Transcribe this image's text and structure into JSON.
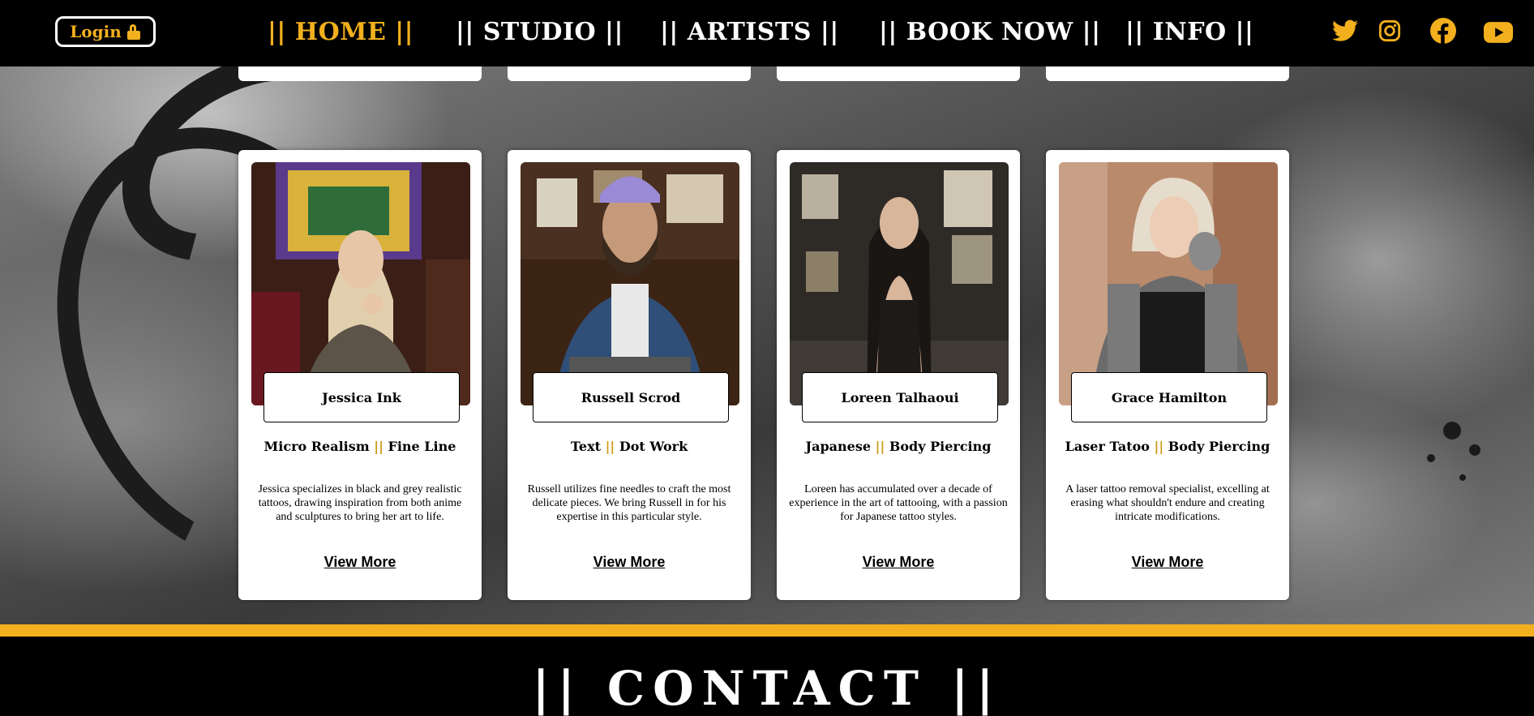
{
  "header": {
    "login_label": "Login",
    "nav": [
      {
        "label": "|| HOME ||",
        "active": true
      },
      {
        "label": "|| STUDIO ||",
        "active": false
      },
      {
        "label": "|| ARTISTS ||",
        "active": false
      },
      {
        "label": "|| BOOK NOW ||",
        "active": false
      },
      {
        "label": "|| INFO ||",
        "active": false
      }
    ],
    "social_icons": [
      "twitter-icon",
      "instagram-icon",
      "facebook-icon",
      "youtube-icon"
    ]
  },
  "artists": [
    {
      "name": "Jessica Ink",
      "specialty_a": "Micro Realism",
      "specialty_sep": "||",
      "specialty_b": "Fine Line",
      "description": "Jessica specializes in black and grey realistic tattoos, drawing inspiration from both anime and sculptures to bring her art to life.",
      "link": "View More"
    },
    {
      "name": "Russell Scrod",
      "specialty_a": "Text",
      "specialty_sep": "||",
      "specialty_b": "Dot Work",
      "description": "Russell utilizes fine needles to craft the most delicate pieces. We bring Russell in for his expertise in this particular style.",
      "link": "View More"
    },
    {
      "name": "Loreen Talhaoui",
      "specialty_a": "Japanese",
      "specialty_sep": "||",
      "specialty_b": "Body Piercing",
      "description": "Loreen has accumulated over a decade of experience in the art of tattooing, with a passion for Japanese tattoo styles.",
      "link": "View More"
    },
    {
      "name": "Grace Hamilton",
      "specialty_a": "Laser Tatoo",
      "specialty_sep": "||",
      "specialty_b": "Body Piercing",
      "description": "A laser tattoo removal specialist, excelling at erasing what shouldn't endure and creating intricate modifications.",
      "link": "View More"
    }
  ],
  "contact": {
    "title": "|| CONTACT ||"
  },
  "colors": {
    "accent": "#f2b01e",
    "header_bg": "#000000",
    "card_bg": "#ffffff"
  }
}
